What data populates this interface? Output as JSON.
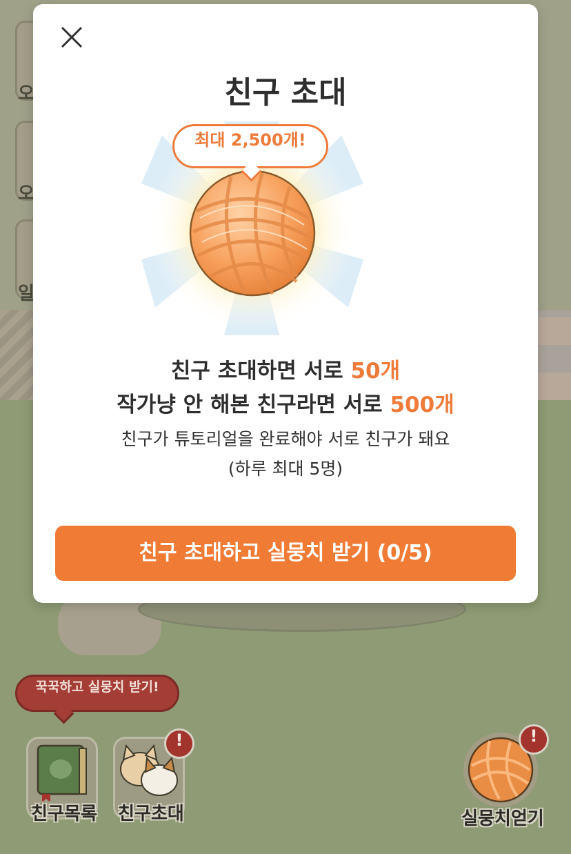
{
  "modal": {
    "title": "친구 초대",
    "bubble": "최대 2,500개!",
    "line1_text": "친구 초대하면 서로 ",
    "line1_highlight": "50개",
    "line2_text": "작가냥 안 해본 친구라면 서로 ",
    "line2_highlight": "500개",
    "sub1": "친구가 튜토리얼을 완료해야 서로 친구가 돼요",
    "sub2": "(하루 최대 5명)",
    "cta_label": "친구 초대하고 실뭉치 받기 (0/5)"
  },
  "bottom": {
    "tip": "꾹꾹하고 실뭉치 받기!",
    "friend_list_label": "친구목록",
    "friend_invite_label": "친구초대",
    "get_yarn_label": "실뭉치얻기",
    "alert_mark": "!"
  },
  "side": {
    "item1_partial": "오",
    "item2_partial": "오",
    "item3_partial": "일"
  },
  "colors": {
    "accent": "#ef7b3a",
    "cta": "#f07b35",
    "tip_bg": "#a43d36",
    "title_text": "#2e2e2e"
  },
  "icons": [
    "close-icon",
    "yarn-ball-icon",
    "book-icon",
    "cats-icon",
    "alert-icon"
  ]
}
